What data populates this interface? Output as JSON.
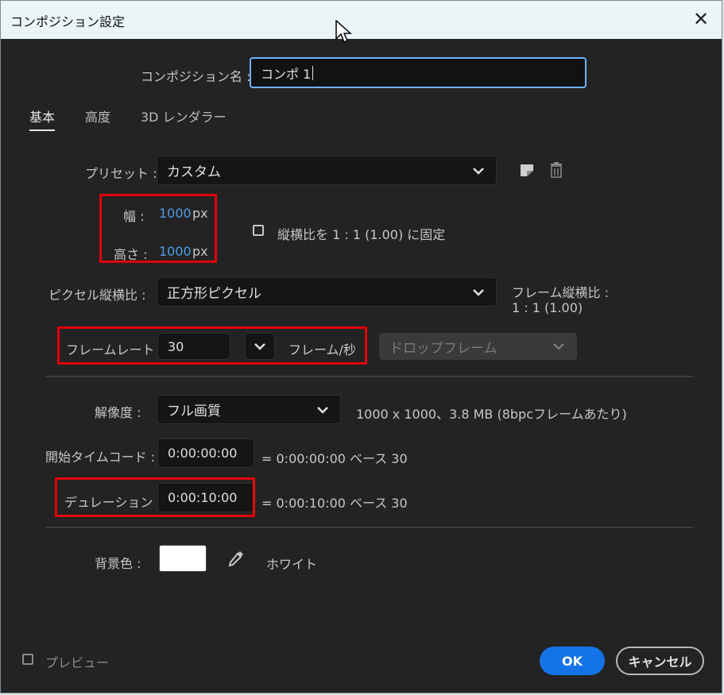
{
  "window": {
    "title": "コンポジション設定"
  },
  "comp_name": {
    "label": "コンポジション名 :",
    "value": "コンポ 1"
  },
  "tabs": [
    {
      "label": "基本"
    },
    {
      "label": "高度"
    },
    {
      "label": "3D レンダラー"
    }
  ],
  "preset": {
    "label": "プリセット :",
    "value": "カスタム"
  },
  "width": {
    "label": "幅 :",
    "value": "1000",
    "unit": "px"
  },
  "height": {
    "label": "高さ :",
    "value": "1000",
    "unit": "px"
  },
  "lock_aspect": {
    "label": "縦横比を 1 : 1 (1.00) に固定"
  },
  "pixel_aspect": {
    "label": "ピクセル縦横比 :",
    "value": "正方形ピクセル"
  },
  "frame_aspect": {
    "label": "フレーム縦横比 :",
    "value": "1 : 1 (1.00)"
  },
  "frame_rate": {
    "label": "フレームレート :",
    "value": "30",
    "unit": "フレーム/秒",
    "drop_frame": "ドロップフレーム"
  },
  "resolution": {
    "label": "解像度 :",
    "value": "フル画質",
    "info": "1000 x 1000、3.8 MB (8bpcフレームあたり)"
  },
  "start_timecode": {
    "label": "開始タイムコード :",
    "value": "0:00:00:00",
    "info": "= 0:00:00:00  ベース 30"
  },
  "duration": {
    "label": "デュレーション :",
    "value": "0:00:10:00",
    "info": "= 0:00:10:00  ベース 30"
  },
  "bg_color": {
    "label": "背景色 :",
    "name": "ホワイト",
    "color": "#ffffff"
  },
  "footer": {
    "preview_label": "プレビュー",
    "ok_label": "OK",
    "cancel_label": "キャンセル"
  },
  "colors": {
    "accent": "#1473e6",
    "value_blue": "#4d9bea",
    "highlight_red": "#e3000b"
  }
}
